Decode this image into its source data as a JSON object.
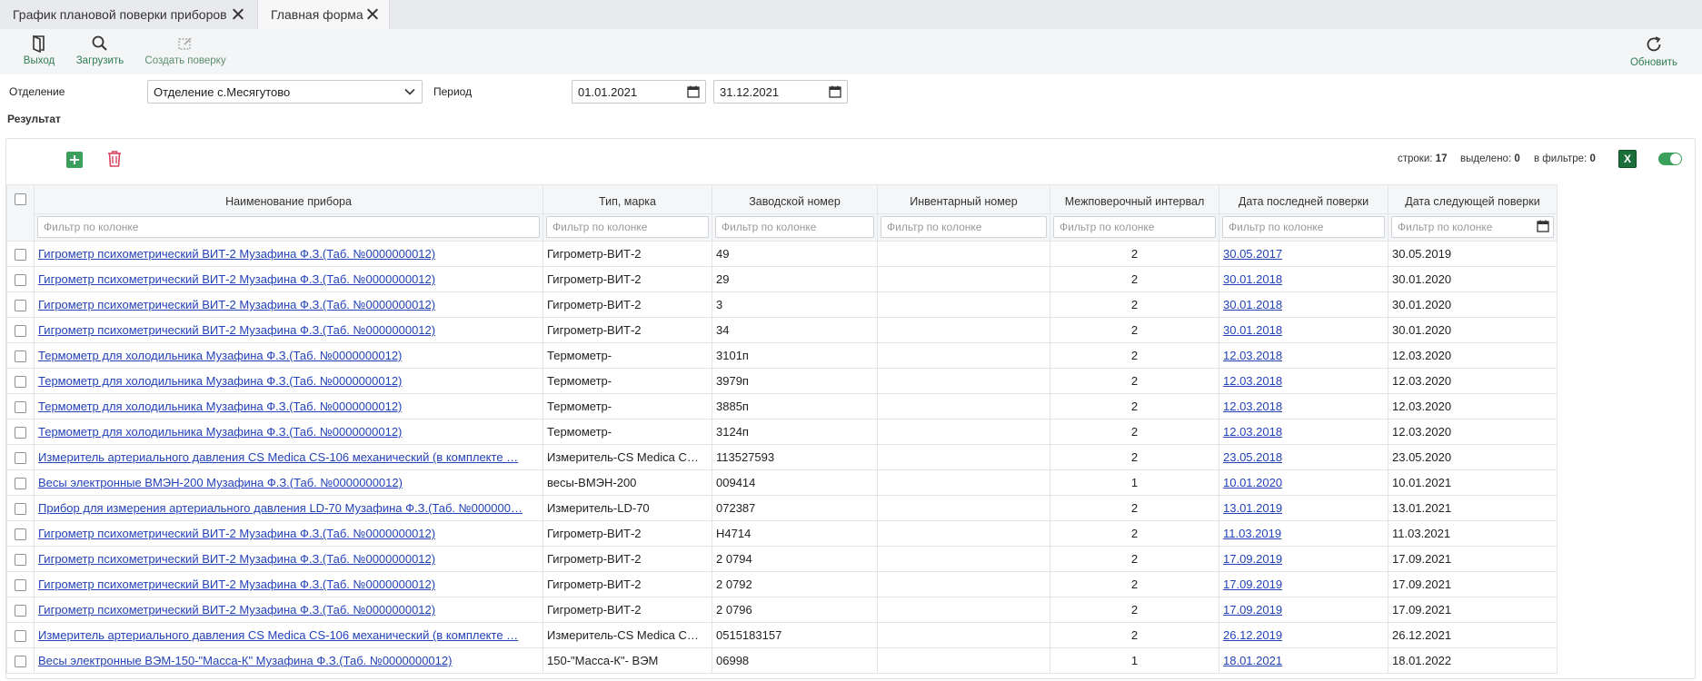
{
  "tabs": [
    {
      "label": "График плановой поверки приборов",
      "active": false
    },
    {
      "label": "Главная форма",
      "active": true
    }
  ],
  "toolbar": {
    "exit_label": "Выход",
    "load_label": "Загрузить",
    "create_label": "Создать поверку",
    "refresh_label": "Обновить"
  },
  "filters": {
    "department_label": "Отделение",
    "department_value": "Отделение  с.Месягутово",
    "period_label": "Период",
    "date_from": "01.01.2021",
    "date_to": "31.12.2021"
  },
  "result_title": "Результат",
  "stats": {
    "rows_label": "строки:",
    "rows_value": "17",
    "selected_label": "выделено:",
    "selected_value": "0",
    "in_filter_label": "в фильтре:",
    "in_filter_value": "0"
  },
  "excel_label": "X",
  "columns": [
    "Наименование прибора",
    "Тип, марка",
    "Заводской номер",
    "Инвентарный номер",
    "Межповерочный интервал",
    "Дата последней поверки",
    "Дата следующей поверки"
  ],
  "filter_placeholder": "Фильтр по колонке",
  "rows": [
    {
      "name": "Гигрометр психометрический ВИТ-2 Музафина Ф.З.(Таб. №0000000012)",
      "type": "Гигрометр-ВИТ-2",
      "serial": "49",
      "inventory": "",
      "interval": "2",
      "last": "30.05.2017",
      "next": "30.05.2019"
    },
    {
      "name": "Гигрометр психометрический ВИТ-2 Музафина Ф.З.(Таб. №0000000012)",
      "type": "Гигрометр-ВИТ-2",
      "serial": "29",
      "inventory": "",
      "interval": "2",
      "last": "30.01.2018",
      "next": "30.01.2020"
    },
    {
      "name": "Гигрометр психометрический ВИТ-2 Музафина Ф.З.(Таб. №0000000012)",
      "type": "Гигрометр-ВИТ-2",
      "serial": "3",
      "inventory": "",
      "interval": "2",
      "last": "30.01.2018",
      "next": "30.01.2020"
    },
    {
      "name": "Гигрометр психометрический ВИТ-2 Музафина Ф.З.(Таб. №0000000012)",
      "type": "Гигрометр-ВИТ-2",
      "serial": "34",
      "inventory": "",
      "interval": "2",
      "last": "30.01.2018",
      "next": "30.01.2020"
    },
    {
      "name": "Термометр для холодильника Музафина Ф.З.(Таб. №0000000012)",
      "type": "Термометр-",
      "serial": "3101п",
      "inventory": "",
      "interval": "2",
      "last": "12.03.2018",
      "next": "12.03.2020"
    },
    {
      "name": "Термометр для холодильника Музафина Ф.З.(Таб. №0000000012)",
      "type": "Термометр-",
      "serial": "3979п",
      "inventory": "",
      "interval": "2",
      "last": "12.03.2018",
      "next": "12.03.2020"
    },
    {
      "name": "Термометр для холодильника Музафина Ф.З.(Таб. №0000000012)",
      "type": "Термометр-",
      "serial": "3885п",
      "inventory": "",
      "interval": "2",
      "last": "12.03.2018",
      "next": "12.03.2020"
    },
    {
      "name": "Термометр для холодильника Музафина Ф.З.(Таб. №0000000012)",
      "type": "Термометр-",
      "serial": "3124п",
      "inventory": "",
      "interval": "2",
      "last": "12.03.2018",
      "next": "12.03.2020"
    },
    {
      "name": "Измеритель артериального давления CS Medica CS-106 механический (в комплекте …",
      "type": "Измеритель-CS Medica C…",
      "serial": "113527593",
      "inventory": "",
      "interval": "2",
      "last": "23.05.2018",
      "next": "23.05.2020"
    },
    {
      "name": "Весы электронные ВМЭН-200 Музафина Ф.З.(Таб. №0000000012)",
      "type": "весы-ВМЭН-200",
      "serial": "009414",
      "inventory": "",
      "interval": "1",
      "last": "10.01.2020",
      "next": "10.01.2021"
    },
    {
      "name": "Прибор для измерения артериального давления LD-70 Музафина Ф.З.(Таб. №000000…",
      "type": "Измеритель-LD-70",
      "serial": "072387",
      "inventory": "",
      "interval": "2",
      "last": "13.01.2019",
      "next": "13.01.2021"
    },
    {
      "name": "Гигрометр психометрический ВИТ-2 Музафина Ф.З.(Таб. №0000000012)",
      "type": "Гигрометр-ВИТ-2",
      "serial": "Н4714",
      "inventory": "",
      "interval": "2",
      "last": "11.03.2019",
      "next": "11.03.2021"
    },
    {
      "name": "Гигрометр психометрический ВИТ-2 Музафина Ф.З.(Таб. №0000000012)",
      "type": "Гигрометр-ВИТ-2",
      "serial": "2 0794",
      "inventory": "",
      "interval": "2",
      "last": "17.09.2019",
      "next": "17.09.2021"
    },
    {
      "name": "Гигрометр психометрический ВИТ-2 Музафина Ф.З.(Таб. №0000000012)",
      "type": "Гигрометр-ВИТ-2",
      "serial": "2 0792",
      "inventory": "",
      "interval": "2",
      "last": "17.09.2019",
      "next": "17.09.2021"
    },
    {
      "name": "Гигрометр психометрический ВИТ-2 Музафина Ф.З.(Таб. №0000000012)",
      "type": "Гигрометр-ВИТ-2",
      "serial": "2 0796",
      "inventory": "",
      "interval": "2",
      "last": "17.09.2019",
      "next": "17.09.2021"
    },
    {
      "name": "Измеритель артериального давления CS Medica CS-106 механический (в комплекте …",
      "type": "Измеритель-CS Medica C…",
      "serial": "0515183157",
      "inventory": "",
      "interval": "2",
      "last": "26.12.2019",
      "next": "26.12.2021"
    },
    {
      "name": "Весы электронные ВЭМ-150-\"Масса-К\" Музафина Ф.З.(Таб. №0000000012)",
      "type": "150-\"Масса-К\"- ВЭМ",
      "serial": "06998",
      "inventory": "",
      "interval": "1",
      "last": "18.01.2021",
      "next": "18.01.2022"
    }
  ]
}
